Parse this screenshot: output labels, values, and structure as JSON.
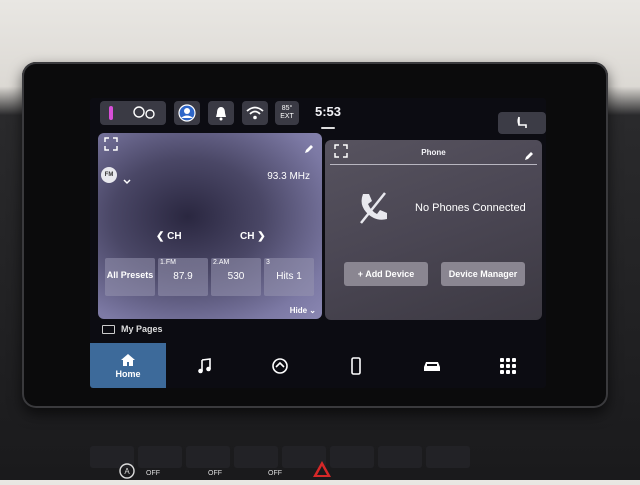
{
  "status_bar": {
    "time": "5:53",
    "temp_line1": "85°",
    "temp_line2": "EXT",
    "icons": [
      "apps-icon",
      "driver-assist-icon",
      "profile-icon",
      "bell-icon",
      "wifi-icon",
      "seat-icon"
    ]
  },
  "radio": {
    "band_badge": "FM",
    "frequency": "93.3 MHz",
    "ch_prev_label": "CH",
    "ch_next_label": "CH",
    "presets": [
      {
        "num": "",
        "label": "All Presets"
      },
      {
        "num": "1.FM",
        "label": "87.9"
      },
      {
        "num": "2.AM",
        "label": "530"
      },
      {
        "num": "3",
        "label": "Hits 1"
      }
    ],
    "hide_label": "Hide"
  },
  "phone": {
    "title": "Phone",
    "status": "No Phones Connected",
    "add_device": "+ Add Device",
    "device_manager": "Device Manager"
  },
  "my_pages": "My Pages",
  "nav": {
    "home_label": "Home",
    "items": [
      "home-icon",
      "music-icon",
      "vehicle-settings-icon",
      "phone-icon",
      "car-icon",
      "apps-grid-icon"
    ]
  },
  "console": {
    "off1": "OFF",
    "off2": "OFF",
    "off3": "OFF"
  }
}
